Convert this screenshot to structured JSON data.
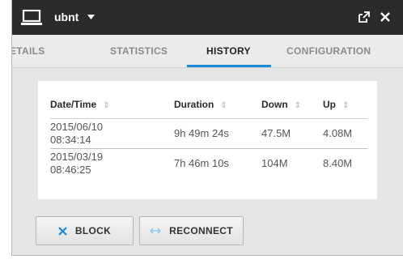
{
  "header": {
    "device_name": "ubnt",
    "icons": {
      "device": "laptop-icon",
      "dropdown": "caret-down-icon",
      "popout": "popout-icon",
      "close": "close-icon"
    }
  },
  "tabs": [
    {
      "label": "DETAILS",
      "active": false
    },
    {
      "label": "STATISTICS",
      "active": false
    },
    {
      "label": "HISTORY",
      "active": true
    },
    {
      "label": "CONFIGURATION",
      "active": false
    }
  ],
  "history_table": {
    "columns": [
      "Date/Time",
      "Duration",
      "Down",
      "Up"
    ],
    "sort_icon": "sort-arrows-icon",
    "rows": [
      {
        "date": "2015/06/10",
        "time": "08:34:14",
        "duration": "9h 49m 24s",
        "down": "47.5M",
        "up": "4.08M"
      },
      {
        "date": "2015/03/19",
        "time": "08:46:25",
        "duration": "7h 46m 10s",
        "down": "104M",
        "up": "8.40M"
      }
    ]
  },
  "actions": {
    "block": {
      "label": "BLOCK",
      "icon": "x-icon"
    },
    "reconnect": {
      "label": "RECONNECT",
      "icon": "bidirectional-arrow-icon"
    }
  },
  "colors": {
    "titlebar": "#2b2b2b",
    "accent": "#1e8bd6",
    "panel_bg": "#e5e5e5"
  }
}
